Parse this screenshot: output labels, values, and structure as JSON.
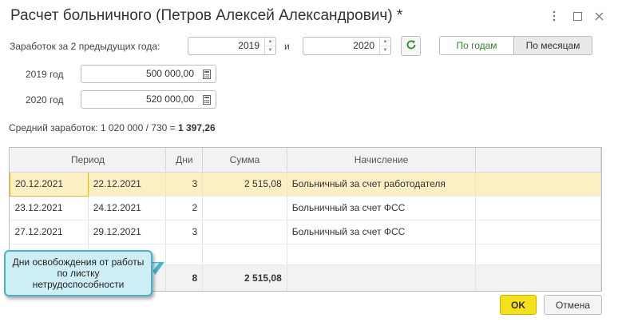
{
  "window": {
    "title": "Расчет больничного (Петров Алексей Александрович) *",
    "more_icon": "more-vert-icon",
    "maximize_icon": "maximize-icon",
    "close_icon": "close-icon"
  },
  "earnings": {
    "label": "Заработок за 2 предыдущих года:",
    "year1": "2019",
    "and_label": "и",
    "year2": "2020",
    "refresh_icon": "refresh-icon",
    "toggle_years": "По годам",
    "toggle_months": "По месяцам",
    "rows": [
      {
        "label": "2019 год",
        "amount": "500 000,00"
      },
      {
        "label": "2020 год",
        "amount": "520 000,00"
      }
    ]
  },
  "summary": {
    "prefix": "Средний заработок: 1 020 000 / 730 = ",
    "result": "1 397,26"
  },
  "table": {
    "headers": {
      "period": "Период",
      "days": "Дни",
      "sum": "Сумма",
      "accrual": "Начисление"
    },
    "rows": [
      {
        "from": "20.12.2021",
        "to": "22.12.2021",
        "days": "3",
        "sum": "2 515,08",
        "accrual": "Больничный за счет работодателя"
      },
      {
        "from": "23.12.2021",
        "to": "24.12.2021",
        "days": "2",
        "sum": "",
        "accrual": "Больничный за счет ФСС"
      },
      {
        "from": "27.12.2021",
        "to": "29.12.2021",
        "days": "3",
        "sum": "",
        "accrual": "Больничный за счет ФСС"
      }
    ],
    "footer": {
      "days": "8",
      "sum": "2 515,08"
    }
  },
  "callout": {
    "text": "Дни освобождения от работы по листку нетрудоспособности"
  },
  "buttons": {
    "ok": "OK",
    "cancel": "Отмена"
  },
  "colors": {
    "accent_green": "#2e8b2e",
    "selected_row": "#fcefc4",
    "ok_button": "#f5e01e",
    "callout_bg": "#cdeef5",
    "callout_border": "#4ab2c9"
  }
}
